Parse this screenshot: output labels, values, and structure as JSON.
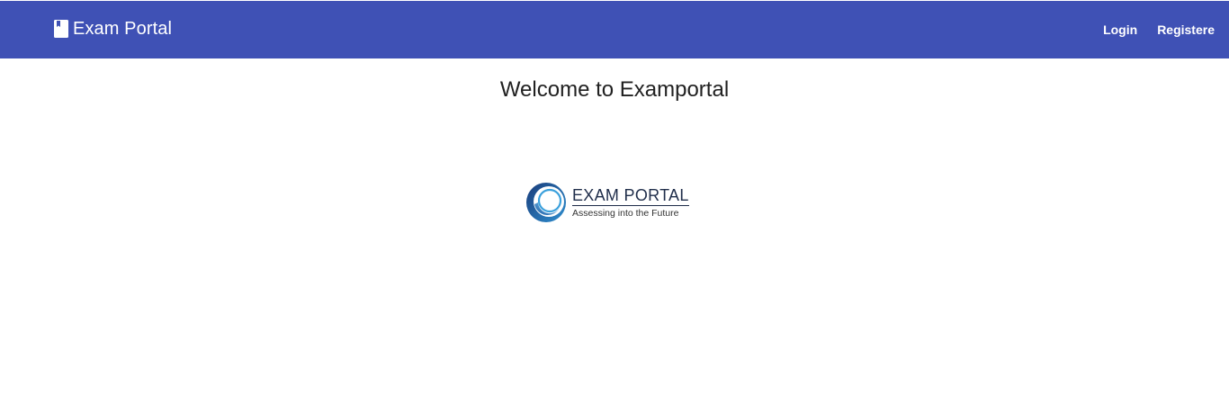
{
  "navbar": {
    "brand": {
      "icon": "book-icon",
      "title": "Exam Portal"
    },
    "links": [
      {
        "label": "Login"
      },
      {
        "label": "Registere"
      }
    ],
    "color": "#3f51b5"
  },
  "main": {
    "heading": "Welcome to Examportal",
    "logo": {
      "title": "EXAM PORTAL",
      "tagline": "Assessing into the Future"
    }
  }
}
